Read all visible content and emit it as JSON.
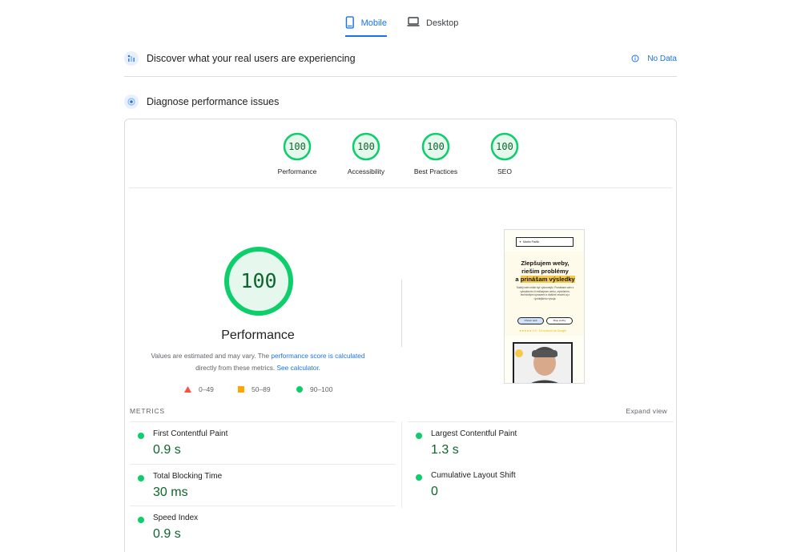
{
  "tabs": {
    "mobile": "Mobile",
    "desktop": "Desktop"
  },
  "field_data": {
    "title": "Discover what your real users are experiencing",
    "status": "No Data"
  },
  "lab_data": {
    "title": "Diagnose performance issues"
  },
  "category_scores": [
    {
      "label": "Performance",
      "score": "100"
    },
    {
      "label": "Accessibility",
      "score": "100"
    },
    {
      "label": "Best Practices",
      "score": "100"
    },
    {
      "label": "SEO",
      "score": "100"
    }
  ],
  "performance": {
    "score": "100",
    "title": "Performance",
    "note_prefix": "Values are estimated and may vary. The ",
    "note_link1": "performance score is calculated",
    "note_middle": " directly from these metrics. ",
    "note_link2": "See calculator",
    "note_suffix": "."
  },
  "legend": {
    "fail": "0–49",
    "average": "50–89",
    "pass": "90–100"
  },
  "colors": {
    "pass": "#0cce6b",
    "pass_text": "#0d652d",
    "average": "#ffa400",
    "fail": "#ff4e42",
    "link": "#1a73e8"
  },
  "screenshot": {
    "brand": "Martin Pavlik",
    "headline_line1": "Zlepšujem weby,",
    "headline_line2": "riešim problémy",
    "headline_line3a": "a ",
    "headline_highlight": "prinášam výsledky",
    "subtext": "Každý web môže byť výkonnejší. Pomáham vám s vylepšením či redizajnom webu, zrýchlením, technickými úpravami a ďalšími vecami aj z rýchlejšieho vývoja.",
    "button1": "Chcem web",
    "button2": "Moje služby",
    "rating": "★★★★★ 4.9 · 15 recenzií na Google"
  },
  "metrics": {
    "section_label": "METRICS",
    "expand_label": "Expand view",
    "items": [
      {
        "name": "First Contentful Paint",
        "value": "0.9 s"
      },
      {
        "name": "Largest Contentful Paint",
        "value": "1.3 s"
      },
      {
        "name": "Total Blocking Time",
        "value": "30 ms"
      },
      {
        "name": "Cumulative Layout Shift",
        "value": "0"
      },
      {
        "name": "Speed Index",
        "value": "0.9 s"
      }
    ]
  }
}
